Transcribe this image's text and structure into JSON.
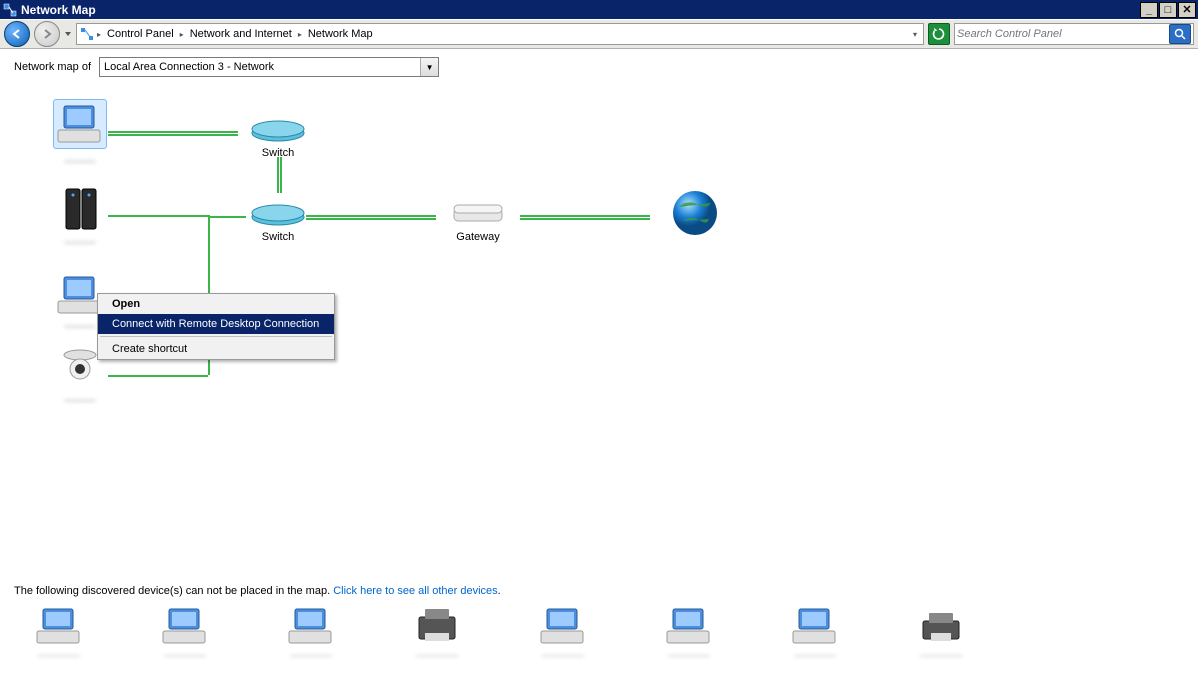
{
  "title": "Network Map",
  "breadcrumb": [
    "Control Panel",
    "Network and Internet",
    "Network Map"
  ],
  "search_placeholder": "Search Control Panel",
  "subbar_label": "Network map of",
  "selected_network": "Local Area Connection 3 - Network",
  "nodes": {
    "switch1": "Switch",
    "switch2": "Switch",
    "gateway": "Gateway"
  },
  "context_menu": {
    "open": "Open",
    "connect": "Connect with Remote Desktop Connection",
    "shortcut": "Create shortcut"
  },
  "footer_msg": "The following discovered device(s) can not be placed in the map. ",
  "footer_link": "Click here to see all other devices",
  "footer_period": "."
}
